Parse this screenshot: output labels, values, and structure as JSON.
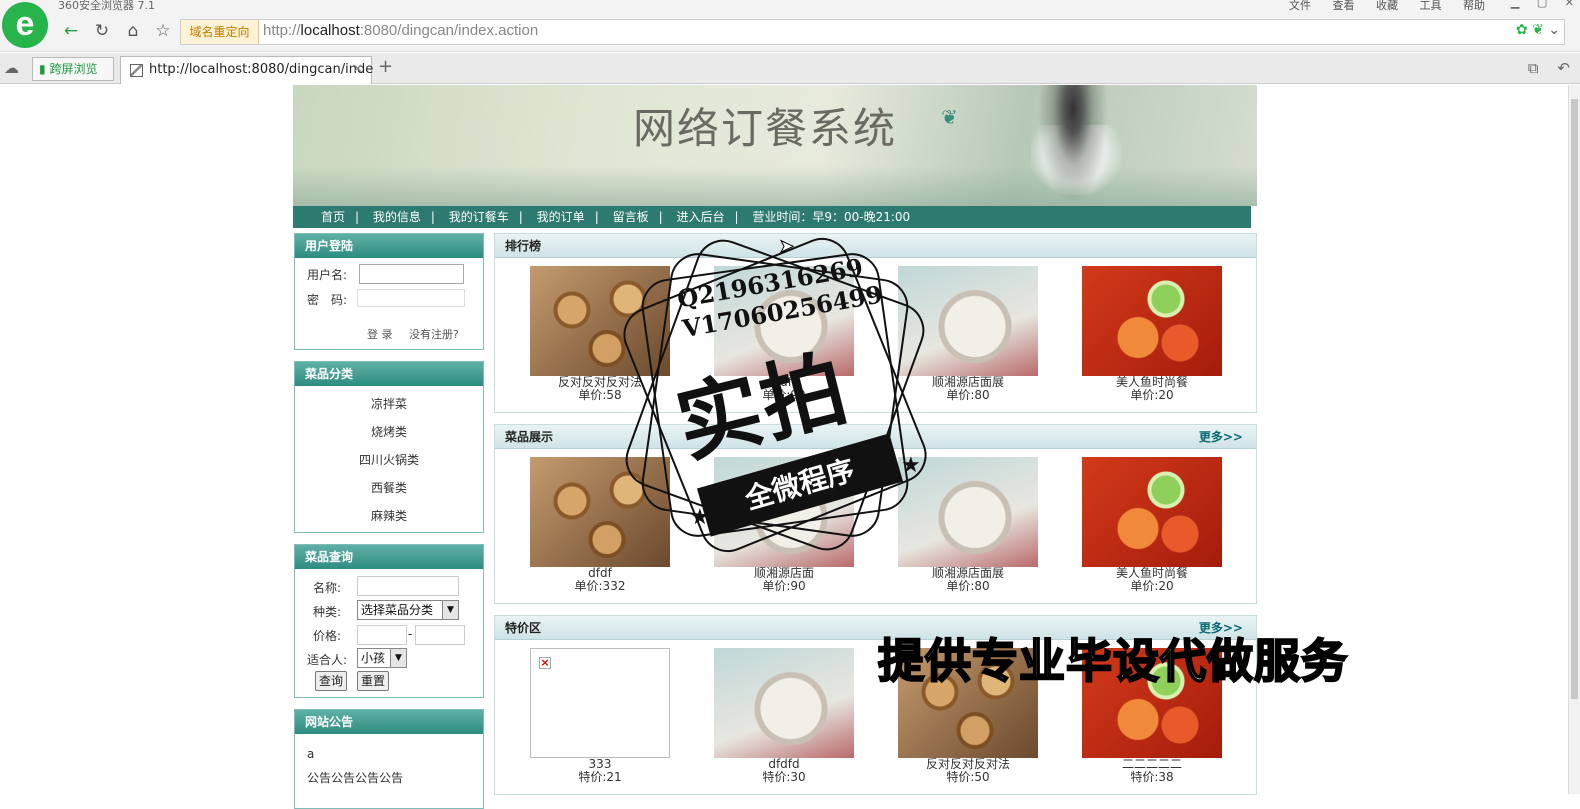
{
  "browser": {
    "app_title": "360安全浏览器 7.1",
    "menu": [
      "文件",
      "查看",
      "收藏",
      "工具",
      "帮助"
    ],
    "redirect_tag": "域名重定向",
    "url_prefix": "http://",
    "url_host": "localhost",
    "url_rest": ":8080/dingcan/index.action",
    "split_tab_label": "跨屏浏览",
    "active_tab_title": "http://localhost:8080/dingcan/inde",
    "logo_letter": "e"
  },
  "site": {
    "title": "网络订餐系统",
    "nav": [
      "首页",
      "我的信息",
      "我的订餐车",
      "我的订单",
      "留言板",
      "进入后台",
      "营业时间：早9：00-晚21:00"
    ],
    "nav_separator": "|"
  },
  "login": {
    "header": "用户登陆",
    "username_label": "用户名:",
    "password_label": "密　码:",
    "login_link": "登 录",
    "register_link": "没有注册?"
  },
  "categories": {
    "header": "菜品分类",
    "items": [
      "凉拌菜",
      "烧烤类",
      "四川火锅类",
      "西餐类",
      "麻辣类"
    ]
  },
  "search": {
    "header": "菜品查询",
    "name_label": "名称:",
    "type_label": "种类:",
    "type_value": "选择菜品分类",
    "price_label": "价格:",
    "price_sep": "-",
    "suitable_label": "适合人:",
    "suitable_value": "小孩",
    "query_button": "查询",
    "reset_button": "重置"
  },
  "notice": {
    "header": "网站公告",
    "items": [
      "a",
      "公告公告公告公告"
    ]
  },
  "ranking": {
    "header": "排行榜",
    "items": [
      {
        "name": "反对反对反对法",
        "price": "单价:58",
        "img": "rolls"
      },
      {
        "name": "dfdfd",
        "price": "单价:90",
        "img": "rice"
      },
      {
        "name": "顺湘源店面展",
        "price": "单价:80",
        "img": "rice"
      },
      {
        "name": "美人鱼时尚餐",
        "price": "单价:20",
        "img": "fish"
      }
    ]
  },
  "showcase": {
    "header": "菜品展示",
    "more": "更多>>",
    "items": [
      {
        "name": "dfdf",
        "price": "单价:332",
        "img": "rolls"
      },
      {
        "name": "顺湘源店面",
        "price": "单价:90",
        "img": "rice"
      },
      {
        "name": "顺湘源店面展",
        "price": "单价:80",
        "img": "rice"
      },
      {
        "name": "美人鱼时尚餐",
        "price": "单价:20",
        "img": "fish"
      }
    ]
  },
  "specials": {
    "header": "特价区",
    "more": "更多>>",
    "items": [
      {
        "name": "333",
        "price": "特价:21",
        "img": "broken"
      },
      {
        "name": "dfdfd",
        "price": "特价:30",
        "img": "rice"
      },
      {
        "name": "反对反对反对法",
        "price": "特价:50",
        "img": "rolls"
      },
      {
        "name": "二二二二二",
        "price": "特价:38",
        "img": "fish"
      }
    ]
  },
  "watermark": {
    "contact_q": "Q2196316269",
    "contact_v": "V17060256499",
    "big_text": "实拍",
    "ribbon_text": "全微程序",
    "service_text": "提供专业毕设代做服务"
  },
  "colors": {
    "accent": "#2d7a70",
    "browser_green": "#27b44a"
  }
}
